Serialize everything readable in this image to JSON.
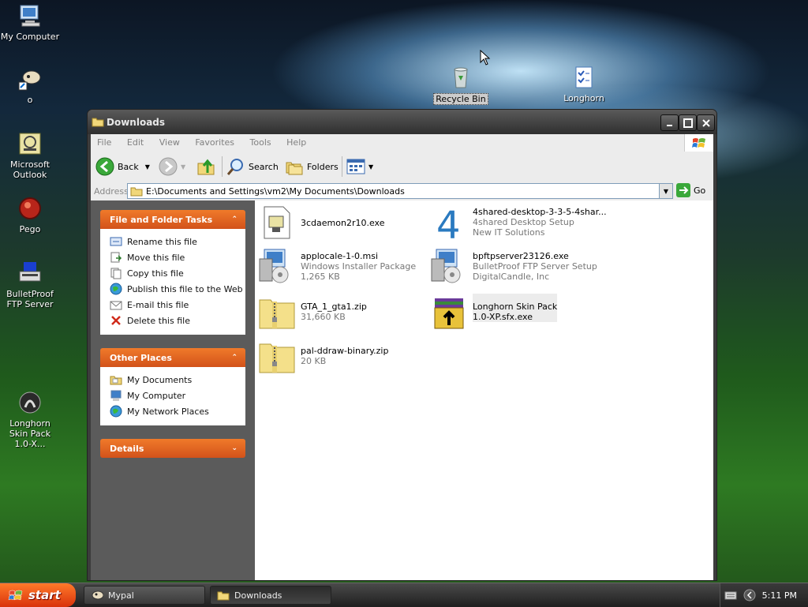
{
  "desktop": {
    "icons": [
      {
        "label": "My Computer"
      },
      {
        "label": "o"
      },
      {
        "label": "Microsoft Outlook"
      },
      {
        "label": "Pego"
      },
      {
        "label": "BulletProof FTP Server"
      },
      {
        "label": "Longhorn Skin Pack 1.0-X..."
      },
      {
        "label": "Recycle Bin"
      },
      {
        "label": "Longhorn"
      }
    ]
  },
  "window": {
    "title": "Downloads",
    "menu": [
      "File",
      "Edit",
      "View",
      "Favorites",
      "Tools",
      "Help"
    ],
    "toolbar": {
      "back": "Back",
      "search": "Search",
      "folders": "Folders"
    },
    "address": {
      "label": "Address",
      "value": "E:\\Documents and Settings\\vm2\\My Documents\\Downloads",
      "go": "Go"
    },
    "tasks_panel": {
      "title": "File and Folder Tasks",
      "items": [
        "Rename this file",
        "Move this file",
        "Copy this file",
        "Publish this file to the Web",
        "E-mail this file",
        "Delete this file"
      ]
    },
    "places_panel": {
      "title": "Other Places",
      "items": [
        "My Documents",
        "My Computer",
        "My Network Places"
      ]
    },
    "details_panel": {
      "title": "Details"
    },
    "files": [
      {
        "name": "3cdaemon2r10.exe",
        "line2": "",
        "line3": ""
      },
      {
        "name": "4shared-desktop-3-3-5-4shar...",
        "line2": "4shared Desktop Setup",
        "line3": "New IT Solutions"
      },
      {
        "name": "applocale-1-0.msi",
        "line2": "Windows Installer Package",
        "line3": "1,265 KB"
      },
      {
        "name": "bpftpserver23126.exe",
        "line2": "BulletProof FTP Server Setup",
        "line3": "DigitalCandle, Inc"
      },
      {
        "name": "GTA_1_gta1.zip",
        "line2": "31,660 KB",
        "line3": ""
      },
      {
        "name": "Longhorn Skin Pack",
        "line2": "1.0-XP.sfx.exe",
        "line3": ""
      },
      {
        "name": "pal-ddraw-binary.zip",
        "line2": "20 KB",
        "line3": ""
      }
    ]
  },
  "taskbar": {
    "start": "start",
    "buttons": [
      "Mypal",
      "Downloads"
    ],
    "clock": "5:11 PM"
  },
  "colors": {
    "accent": "#e0621f",
    "panel_bg": "#5b5b5b"
  }
}
